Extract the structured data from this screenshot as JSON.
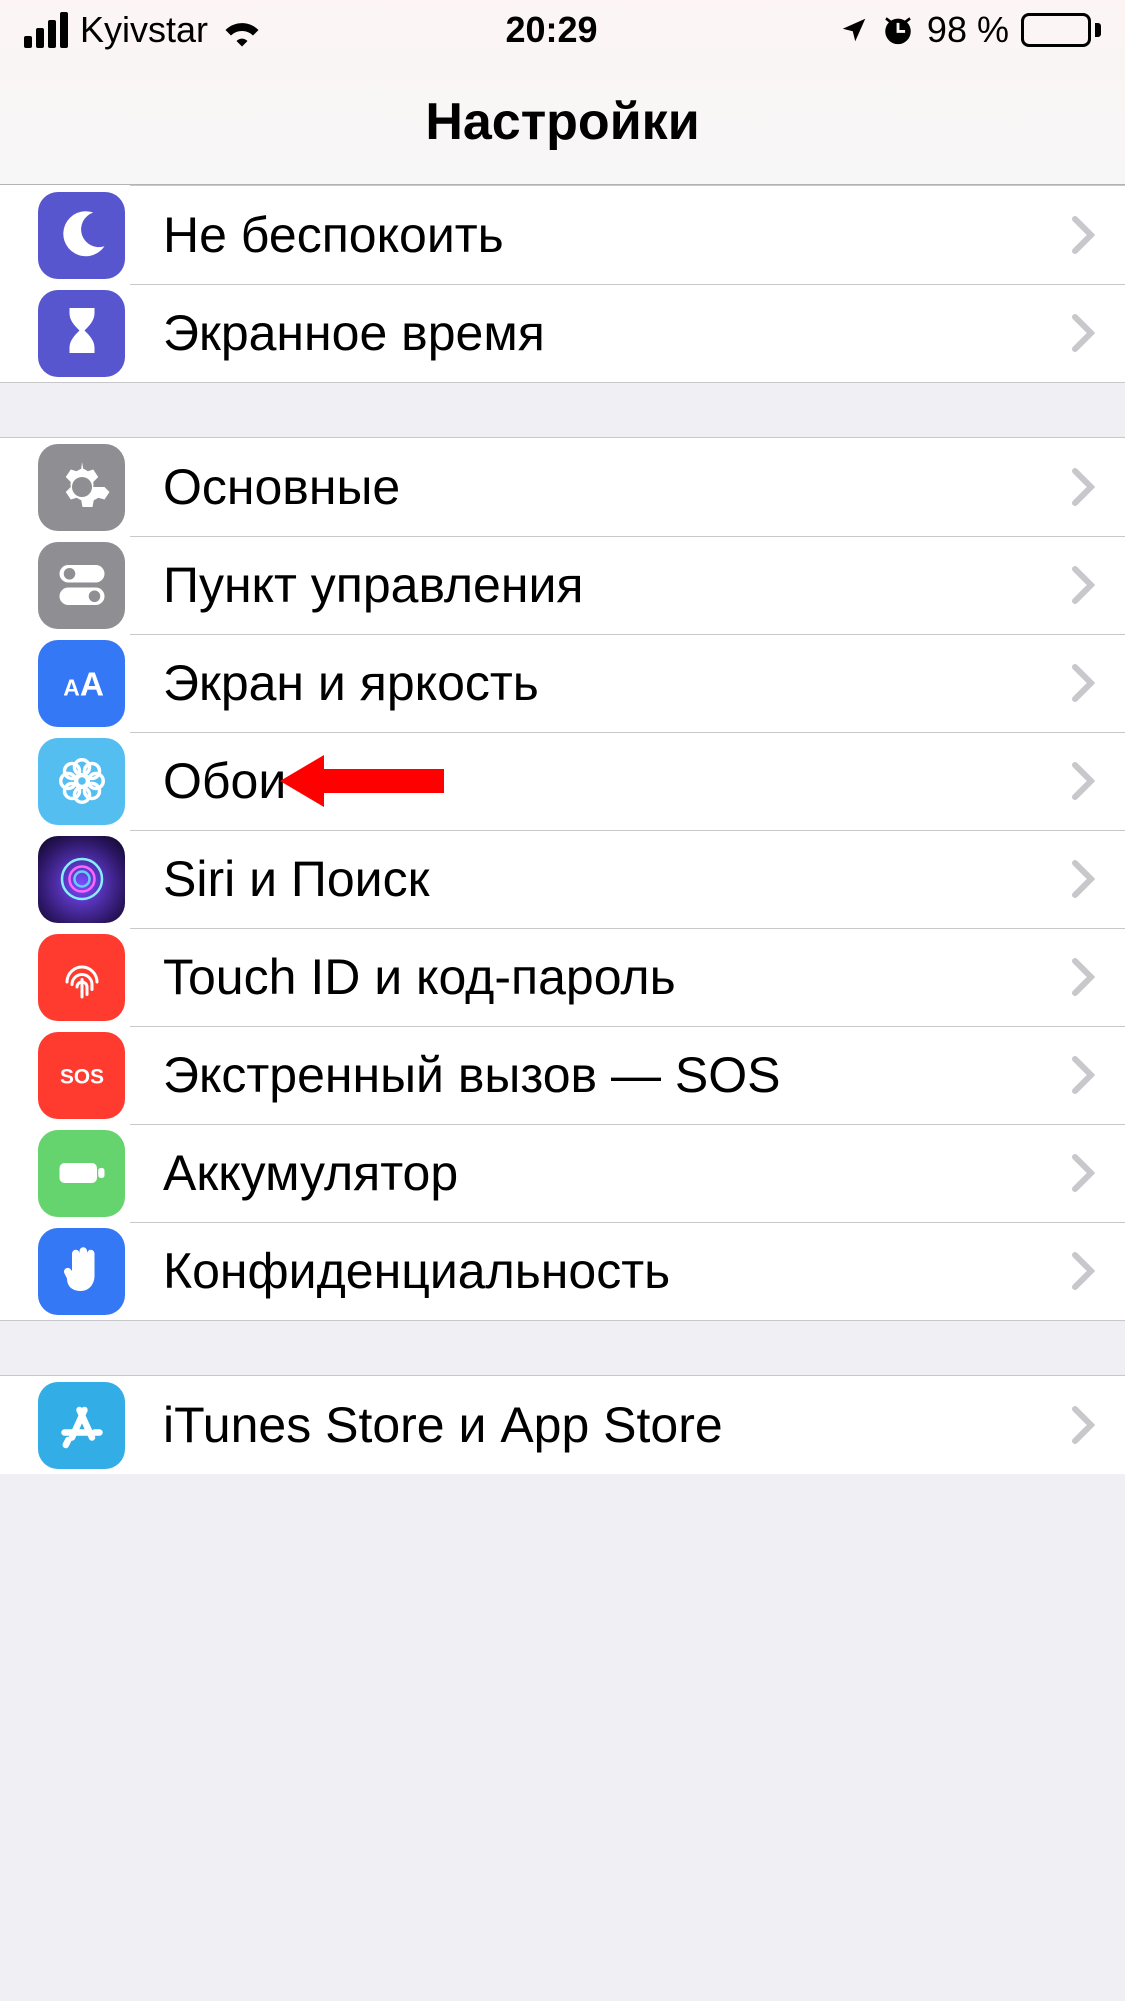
{
  "status": {
    "carrier": "Kyivstar",
    "time": "20:29",
    "battery_pct": "98 %"
  },
  "header": {
    "title": "Настройки"
  },
  "groups": [
    {
      "rows": [
        {
          "label": "Не беспокоить"
        },
        {
          "label": "Экранное время"
        }
      ]
    },
    {
      "rows": [
        {
          "label": "Основные"
        },
        {
          "label": "Пункт управления"
        },
        {
          "label": "Экран и яркость"
        },
        {
          "label": "Обои"
        },
        {
          "label": "Siri и Поиск"
        },
        {
          "label": "Touch ID и код-пароль"
        },
        {
          "label": "Экстренный вызов — SOS"
        },
        {
          "label": "Аккумулятор"
        },
        {
          "label": "Конфиденциальность"
        }
      ]
    },
    {
      "rows": [
        {
          "label": "iTunes Store и App Store"
        }
      ]
    }
  ]
}
